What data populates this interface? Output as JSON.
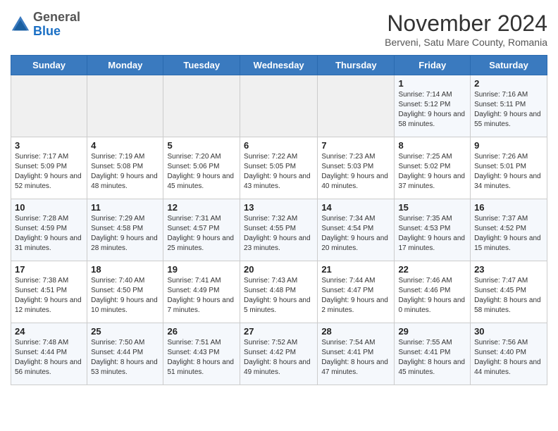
{
  "header": {
    "logo": {
      "line1": "General",
      "line2": "Blue"
    },
    "title": "November 2024",
    "location": "Berveni, Satu Mare County, Romania"
  },
  "days_of_week": [
    "Sunday",
    "Monday",
    "Tuesday",
    "Wednesday",
    "Thursday",
    "Friday",
    "Saturday"
  ],
  "weeks": [
    {
      "days": [
        {
          "num": "",
          "info": ""
        },
        {
          "num": "",
          "info": ""
        },
        {
          "num": "",
          "info": ""
        },
        {
          "num": "",
          "info": ""
        },
        {
          "num": "",
          "info": ""
        },
        {
          "num": "1",
          "info": "Sunrise: 7:14 AM\nSunset: 5:12 PM\nDaylight: 9 hours and 58 minutes."
        },
        {
          "num": "2",
          "info": "Sunrise: 7:16 AM\nSunset: 5:11 PM\nDaylight: 9 hours and 55 minutes."
        }
      ]
    },
    {
      "days": [
        {
          "num": "3",
          "info": "Sunrise: 7:17 AM\nSunset: 5:09 PM\nDaylight: 9 hours and 52 minutes."
        },
        {
          "num": "4",
          "info": "Sunrise: 7:19 AM\nSunset: 5:08 PM\nDaylight: 9 hours and 48 minutes."
        },
        {
          "num": "5",
          "info": "Sunrise: 7:20 AM\nSunset: 5:06 PM\nDaylight: 9 hours and 45 minutes."
        },
        {
          "num": "6",
          "info": "Sunrise: 7:22 AM\nSunset: 5:05 PM\nDaylight: 9 hours and 43 minutes."
        },
        {
          "num": "7",
          "info": "Sunrise: 7:23 AM\nSunset: 5:03 PM\nDaylight: 9 hours and 40 minutes."
        },
        {
          "num": "8",
          "info": "Sunrise: 7:25 AM\nSunset: 5:02 PM\nDaylight: 9 hours and 37 minutes."
        },
        {
          "num": "9",
          "info": "Sunrise: 7:26 AM\nSunset: 5:01 PM\nDaylight: 9 hours and 34 minutes."
        }
      ]
    },
    {
      "days": [
        {
          "num": "10",
          "info": "Sunrise: 7:28 AM\nSunset: 4:59 PM\nDaylight: 9 hours and 31 minutes."
        },
        {
          "num": "11",
          "info": "Sunrise: 7:29 AM\nSunset: 4:58 PM\nDaylight: 9 hours and 28 minutes."
        },
        {
          "num": "12",
          "info": "Sunrise: 7:31 AM\nSunset: 4:57 PM\nDaylight: 9 hours and 25 minutes."
        },
        {
          "num": "13",
          "info": "Sunrise: 7:32 AM\nSunset: 4:55 PM\nDaylight: 9 hours and 23 minutes."
        },
        {
          "num": "14",
          "info": "Sunrise: 7:34 AM\nSunset: 4:54 PM\nDaylight: 9 hours and 20 minutes."
        },
        {
          "num": "15",
          "info": "Sunrise: 7:35 AM\nSunset: 4:53 PM\nDaylight: 9 hours and 17 minutes."
        },
        {
          "num": "16",
          "info": "Sunrise: 7:37 AM\nSunset: 4:52 PM\nDaylight: 9 hours and 15 minutes."
        }
      ]
    },
    {
      "days": [
        {
          "num": "17",
          "info": "Sunrise: 7:38 AM\nSunset: 4:51 PM\nDaylight: 9 hours and 12 minutes."
        },
        {
          "num": "18",
          "info": "Sunrise: 7:40 AM\nSunset: 4:50 PM\nDaylight: 9 hours and 10 minutes."
        },
        {
          "num": "19",
          "info": "Sunrise: 7:41 AM\nSunset: 4:49 PM\nDaylight: 9 hours and 7 minutes."
        },
        {
          "num": "20",
          "info": "Sunrise: 7:43 AM\nSunset: 4:48 PM\nDaylight: 9 hours and 5 minutes."
        },
        {
          "num": "21",
          "info": "Sunrise: 7:44 AM\nSunset: 4:47 PM\nDaylight: 9 hours and 2 minutes."
        },
        {
          "num": "22",
          "info": "Sunrise: 7:46 AM\nSunset: 4:46 PM\nDaylight: 9 hours and 0 minutes."
        },
        {
          "num": "23",
          "info": "Sunrise: 7:47 AM\nSunset: 4:45 PM\nDaylight: 8 hours and 58 minutes."
        }
      ]
    },
    {
      "days": [
        {
          "num": "24",
          "info": "Sunrise: 7:48 AM\nSunset: 4:44 PM\nDaylight: 8 hours and 56 minutes."
        },
        {
          "num": "25",
          "info": "Sunrise: 7:50 AM\nSunset: 4:44 PM\nDaylight: 8 hours and 53 minutes."
        },
        {
          "num": "26",
          "info": "Sunrise: 7:51 AM\nSunset: 4:43 PM\nDaylight: 8 hours and 51 minutes."
        },
        {
          "num": "27",
          "info": "Sunrise: 7:52 AM\nSunset: 4:42 PM\nDaylight: 8 hours and 49 minutes."
        },
        {
          "num": "28",
          "info": "Sunrise: 7:54 AM\nSunset: 4:41 PM\nDaylight: 8 hours and 47 minutes."
        },
        {
          "num": "29",
          "info": "Sunrise: 7:55 AM\nSunset: 4:41 PM\nDaylight: 8 hours and 45 minutes."
        },
        {
          "num": "30",
          "info": "Sunrise: 7:56 AM\nSunset: 4:40 PM\nDaylight: 8 hours and 44 minutes."
        }
      ]
    }
  ]
}
